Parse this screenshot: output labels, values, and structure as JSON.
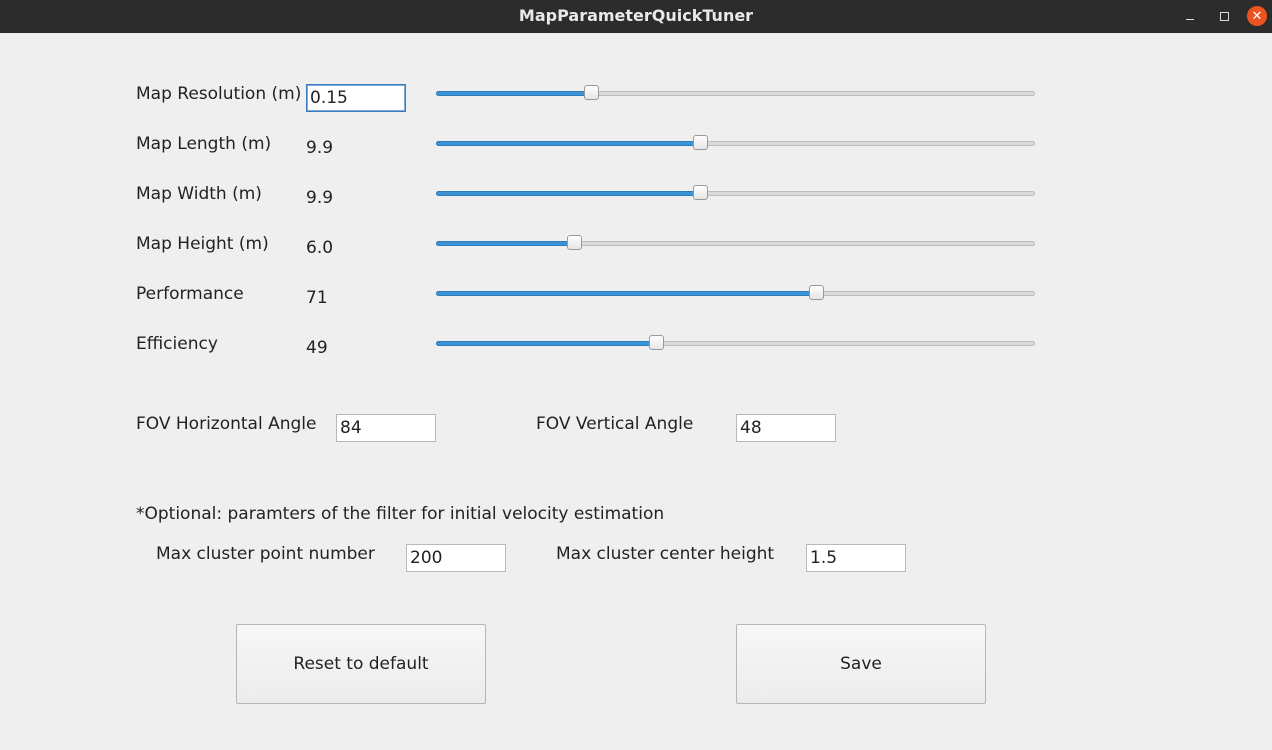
{
  "window": {
    "title": "MapParameterQuickTuner",
    "min_icon": "minimize-icon",
    "max_icon": "maximize-icon",
    "close_icon": "close-icon",
    "close_color": "#e95420"
  },
  "sliders": [
    {
      "label": "Map Resolution (m)",
      "value": "0.15",
      "fraction": 0.258,
      "editable": true
    },
    {
      "label": "Map Length (m)",
      "value": "9.9",
      "fraction": 0.44,
      "editable": false
    },
    {
      "label": "Map Width (m)",
      "value": "9.9",
      "fraction": 0.44,
      "editable": false
    },
    {
      "label": "Map Height (m)",
      "value": "6.0",
      "fraction": 0.23,
      "editable": false
    },
    {
      "label": "Performance",
      "value": "71",
      "fraction": 0.635,
      "editable": false
    },
    {
      "label": "Efficiency",
      "value": "49",
      "fraction": 0.368,
      "editable": false
    }
  ],
  "fov": {
    "horizontal_label": "FOV Horizontal Angle",
    "horizontal_value": "84",
    "vertical_label": "FOV Vertical Angle",
    "vertical_value": "48"
  },
  "optional": {
    "heading": "*Optional: paramters of the filter for initial velocity estimation",
    "point_label": "Max cluster point number",
    "point_value": "200",
    "height_label": "Max cluster center height",
    "height_value": "1.5"
  },
  "buttons": {
    "reset_label": "Reset to default",
    "save_label": "Save"
  },
  "colors": {
    "accent": "#3a93d6",
    "titlebar": "#2c2c2c",
    "background": "#efefef"
  }
}
